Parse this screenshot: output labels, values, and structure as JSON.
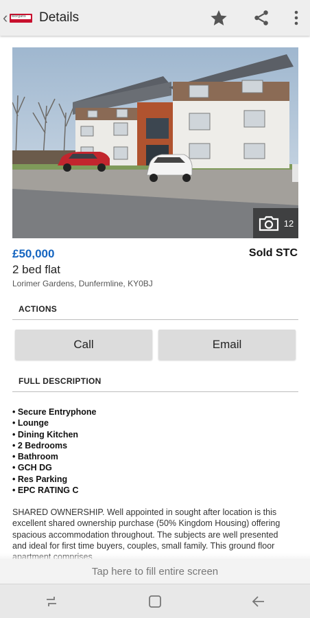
{
  "app_bar": {
    "title": "Details",
    "logo_text": "Morgans",
    "icons": [
      "back-chevron-icon",
      "star-icon",
      "share-icon",
      "more-vert-icon"
    ]
  },
  "photo": {
    "count": "12",
    "icon": "camera-icon"
  },
  "listing": {
    "price": "£50,000",
    "status": "Sold STC",
    "property_type": "2 bed flat",
    "address": "Lorimer Gardens, Dunfermline, KY0BJ"
  },
  "actions": {
    "heading": "ACTIONS",
    "call_label": "Call",
    "email_label": "Email"
  },
  "description": {
    "heading": "FULL DESCRIPTION",
    "features": [
      "• Secure Entryphone",
      "• Lounge",
      "• Dining Kitchen",
      "• 2 Bedrooms",
      "• Bathroom",
      "• GCH DG",
      "• Res Parking",
      "• EPC RATING C"
    ],
    "text": "SHARED OWNERSHIP. Well appointed in sought after location is this excellent shared ownership purchase (50% Kingdom Housing) offering spacious accommodation throughout. The subjects are well presented and ideal for first time buyers, couples, small family. This ground floor apartment comprises"
  },
  "fullscreen_hint": "Tap here to fill entire screen",
  "nav_bar": {
    "icons": [
      "recents-icon",
      "home-icon",
      "back-arrow-icon"
    ]
  },
  "colors": {
    "price": "#1565c0",
    "app_bar_bg": "#eeeeee",
    "button_bg": "#dcdcdc",
    "logo_red": "#c8102e"
  }
}
